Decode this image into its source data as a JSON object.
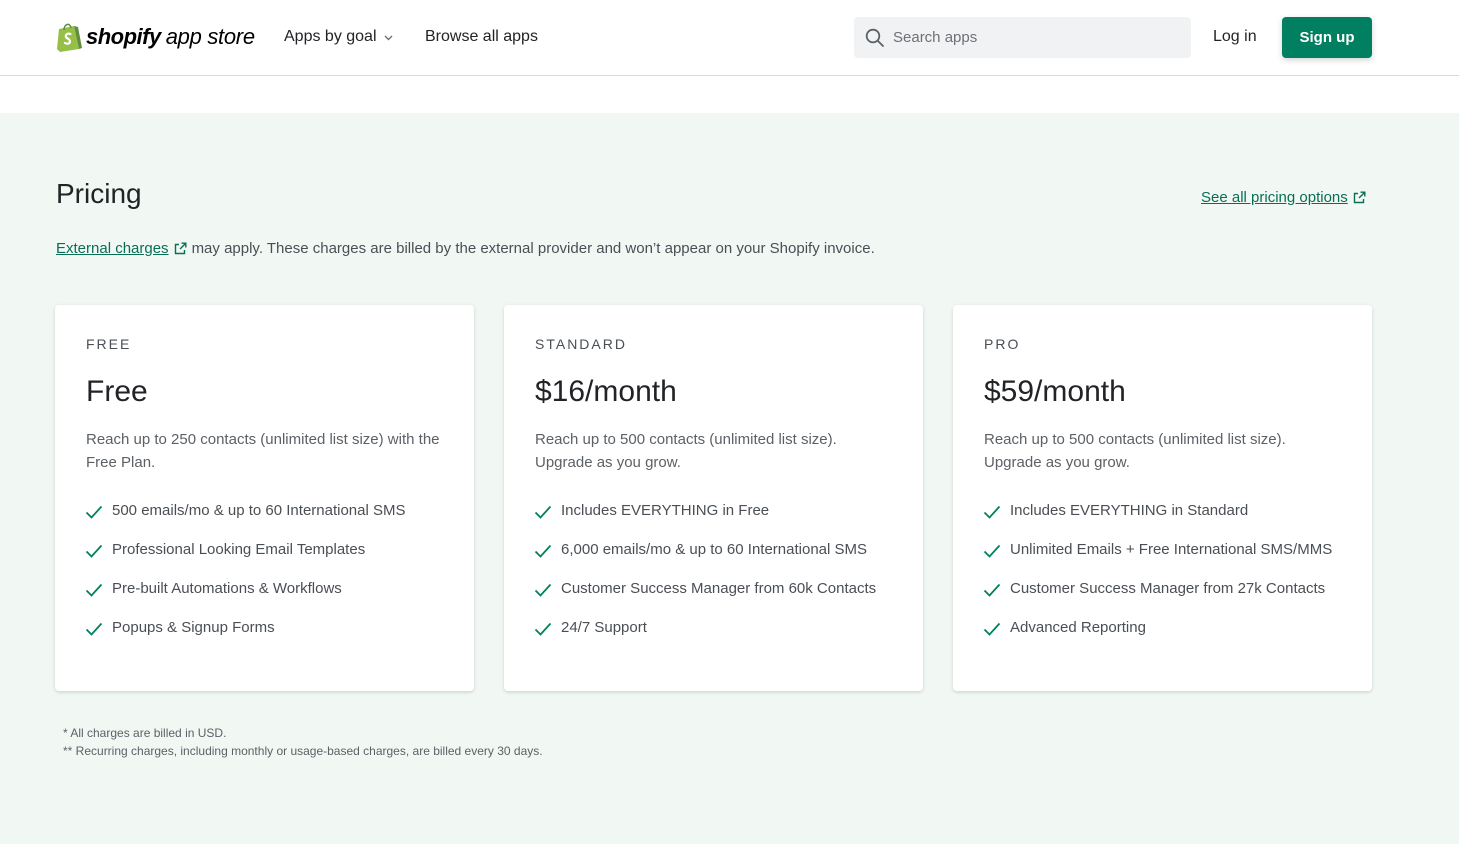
{
  "header": {
    "logo_shopify": "shopify",
    "logo_appstore": "app store",
    "nav_goal": "Apps by goal",
    "nav_browse": "Browse all apps",
    "search_placeholder": "Search apps",
    "login": "Log in",
    "signup": "Sign up",
    "brand_color": "#008060"
  },
  "pricing": {
    "title": "Pricing",
    "see_all": "See all pricing options",
    "external_link": "External charges",
    "external_text": "may apply. These charges are billed by the external provider and won’t appear on your Shopify invoice.",
    "plans": [
      {
        "name": "FREE",
        "price": "Free",
        "description": "Reach up to 250 contacts (unlimited list size) with the Free Plan.",
        "features": [
          "500 emails/mo & up to 60 International SMS",
          "Professional Looking Email Templates",
          "Pre-built Automations & Workflows",
          "Popups & Signup Forms"
        ]
      },
      {
        "name": "STANDARD",
        "price": "$16/month",
        "description": "Reach up to 500 contacts (unlimited list size). Upgrade as you grow.",
        "features": [
          "Includes EVERYTHING in Free",
          "6,000 emails/mo & up to 60 International SMS",
          "Customer Success Manager from 60k Contacts",
          "24/7 Support"
        ]
      },
      {
        "name": "PRO",
        "price": "$59/month",
        "description": "Reach up to 500 contacts (unlimited list size). Upgrade as you grow.",
        "features": [
          "Includes EVERYTHING in Standard",
          "Unlimited Emails + Free International SMS/MMS",
          "Customer Success Manager from 27k Contacts",
          "Advanced Reporting"
        ]
      }
    ],
    "footnote_1": "* All charges are billed in USD.",
    "footnote_2": "** Recurring charges, including monthly or usage-based charges, are billed every 30 days.",
    "check_color": "#008060",
    "background_color": "#f1f8f4"
  }
}
